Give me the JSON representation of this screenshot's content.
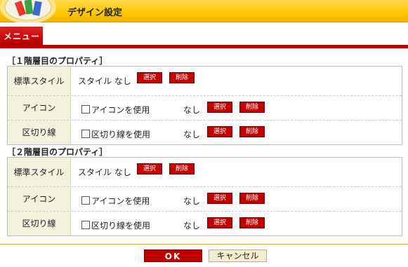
{
  "window": {
    "title": "デザイン設定"
  },
  "menu": {
    "tab_label": "メニュー"
  },
  "sections": [
    {
      "heading": "［１階層目のプロパティ］",
      "rows": [
        {
          "label": "標準スタイル",
          "value": "スタイル なし",
          "select": "選択",
          "delete": "削除"
        },
        {
          "label": "アイコン",
          "checkbox_label": "アイコンを使用",
          "checked": false,
          "value": "なし",
          "select": "選択",
          "delete": "削除"
        },
        {
          "label": "区切り線",
          "checkbox_label": "区切り線を使用",
          "checked": false,
          "value": "なし",
          "select": "選択",
          "delete": "削除"
        }
      ]
    },
    {
      "heading": "［２階層目のプロパティ］",
      "rows": [
        {
          "label": "標準スタイル",
          "value": "スタイル なし",
          "select": "選択",
          "delete": "削除"
        },
        {
          "label": "アイコン",
          "checkbox_label": "アイコンを使用",
          "checked": false,
          "value": "なし",
          "select": "選択",
          "delete": "削除"
        },
        {
          "label": "区切り線",
          "checkbox_label": "区切り線を使用",
          "checked": false,
          "value": "なし",
          "select": "選択",
          "delete": "削除"
        }
      ]
    }
  ],
  "footer": {
    "ok_label": "OK",
    "cancel_label": "キャンセル"
  },
  "colors": {
    "accent": "#c00000",
    "title_bar": "#ffc900",
    "label_bg": "#f4f1dc"
  },
  "icons": {
    "logo": "design-palette-icon"
  }
}
